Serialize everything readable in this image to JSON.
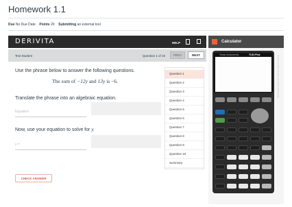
{
  "assignment": {
    "title": "Homework 1.1",
    "due_label": "Due",
    "due_value": "No Due Date",
    "points_label": "Points",
    "points_value": "20",
    "submitting_label": "Submitting",
    "submitting_value": "an external tool"
  },
  "derivita": {
    "logo": "DERIVITA",
    "help": "HELP",
    "student": "Test Student",
    "counter": "Question 1 of 10",
    "prev": "PREV",
    "next": "NEXT"
  },
  "question": {
    "instructions": "Use the phrase below to answer the following questions.",
    "sentence_pre": "The sum of",
    "term1": "−12y",
    "sentence_mid": "and",
    "term2": "13y",
    "sentence_is": "is",
    "result": "−6.",
    "translate_prompt": "Translate the phrase into an algebraic equation.",
    "equation_placeholder": "Equation",
    "solve_prompt": "Now, use your equation to solve for",
    "solve_var": "y.",
    "y_placeholder": "y =",
    "check_answer": "CHECK ANSWER"
  },
  "question_list": [
    "Question 1",
    "Question 2",
    "Question 3",
    "Question 4",
    "Question 5",
    "Question 6",
    "Question 7",
    "Question 8",
    "Question 9",
    "Question 10",
    "Summary"
  ],
  "calculator": {
    "title": "Calculator",
    "brand": "Texas Instruments",
    "model": "TI-84 Plus",
    "side_text": "Portions of this calculator by Texas Instruments"
  },
  "colors": {
    "accent": "#d55c43",
    "active_question": "#fbe4dc",
    "header_dark": "#2b2b2b"
  },
  "icons": {
    "calculator": "calculator-icon",
    "fullscreen": "fullscreen-icon"
  }
}
